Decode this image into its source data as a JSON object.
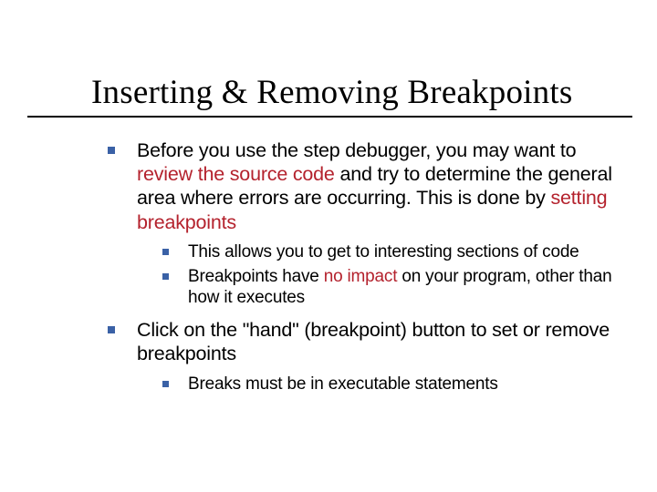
{
  "title": "Inserting & Removing Breakpoints",
  "p1_a": "Before you use the step debugger, you may want to ",
  "p1_b": "review the source code",
  "p1_c": " and try to determine the general area where errors are occurring. This is done by ",
  "p1_d": "setting breakpoints",
  "s1": "This allows you to get to interesting sections of code",
  "s2_a": "Breakpoints have ",
  "s2_b": "no impact",
  "s2_c": " on your program, other than how it executes",
  "p2": "Click on the \"hand\" (breakpoint) button to set or remove breakpoints",
  "s3": "Breaks must be in executable statements"
}
